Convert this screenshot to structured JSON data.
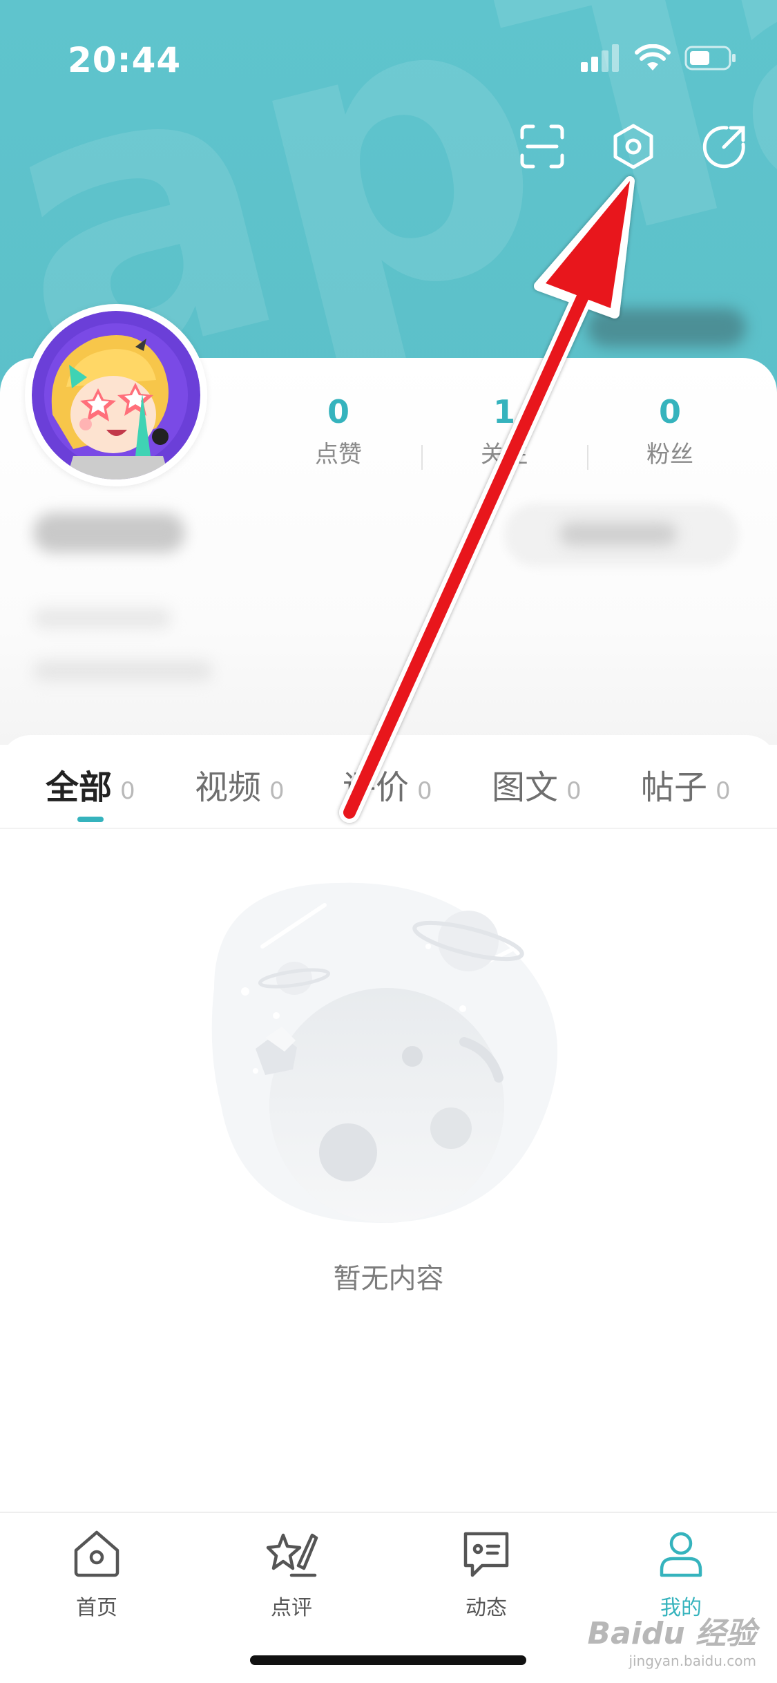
{
  "status_bar": {
    "time": "20:44"
  },
  "header": {
    "watermark": "apTap",
    "actions": [
      {
        "icon": "scan-icon"
      },
      {
        "icon": "settings-hexagon-icon"
      },
      {
        "icon": "share-icon"
      }
    ]
  },
  "profile": {
    "stats": [
      {
        "value": "0",
        "label": "点赞"
      },
      {
        "value": "1",
        "label": "关注"
      },
      {
        "value": "0",
        "label": "粉丝"
      }
    ]
  },
  "tabs": [
    {
      "label": "全部",
      "count": "0",
      "active": true
    },
    {
      "label": "视频",
      "count": "0",
      "active": false
    },
    {
      "label": "评价",
      "count": "0",
      "active": false
    },
    {
      "label": "图文",
      "count": "0",
      "active": false
    },
    {
      "label": "帖子",
      "count": "0",
      "active": false
    }
  ],
  "empty_state": {
    "text": "暂无内容"
  },
  "bottom_nav": [
    {
      "label": "首页",
      "icon": "home-icon",
      "active": false
    },
    {
      "label": "点评",
      "icon": "review-pen-icon",
      "active": false
    },
    {
      "label": "动态",
      "icon": "message-icon",
      "active": false
    },
    {
      "label": "我的",
      "icon": "profile-icon",
      "active": true
    }
  ],
  "colors": {
    "header_bg": "#5fc4cd",
    "accent": "#35b3bd",
    "annotation_arrow": "#e8141c"
  },
  "watermark_overlay": {
    "logo": "Baidu 经验",
    "url": "jingyan.baidu.com"
  }
}
